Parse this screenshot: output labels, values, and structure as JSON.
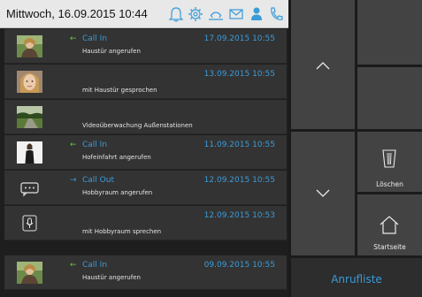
{
  "header": {
    "datetime": "Mittwoch, 16.09.2015 10:44",
    "status_icons": [
      "bell-icon",
      "gear-icon",
      "sun-icon",
      "mail-icon",
      "person-icon",
      "phone-icon"
    ]
  },
  "calls": [
    {
      "thumb": "woman-portrait",
      "direction": "in",
      "arrow": "←",
      "type": "Call In",
      "timestamp": "17.09.2015 10:55",
      "description": "Haustür angerufen"
    },
    {
      "thumb": "woman-closeup",
      "direction": "",
      "arrow": "",
      "type": "",
      "timestamp": "13.09.2015 10:55",
      "description": "mit Haustür gesprochen"
    },
    {
      "thumb": "outdoor-camera",
      "direction": "",
      "arrow": "",
      "type": "",
      "timestamp": "",
      "description": "Videoüberwachung Außenstationen"
    },
    {
      "thumb": "woman-fullbody",
      "direction": "in",
      "arrow": "←",
      "type": "Call In",
      "timestamp": "11.09.2015 10:55",
      "description": "Hofeinfahrt angerufen"
    },
    {
      "thumb": "intercom-device",
      "direction": "out",
      "arrow": "→",
      "type": "Call Out",
      "timestamp": "12.09.2015 10:55",
      "description": "Hobbyraum angerufen"
    },
    {
      "thumb": "microphone-device",
      "direction": "",
      "arrow": "",
      "type": "",
      "timestamp": "12.09.2015 10:53",
      "description": "mit Hobbyraum sprechen"
    },
    {
      "thumb": "woman-portrait",
      "direction": "in",
      "arrow": "←",
      "type": "Call In",
      "timestamp": "09.09.2015 10:55",
      "description": "Haustür angerufen"
    }
  ],
  "side": {
    "up_icon": "chevron-up-icon",
    "down_icon": "chevron-down-icon",
    "delete_label": "Löschen",
    "delete_icon": "trash-icon",
    "home_label": "Startseite",
    "home_icon": "home-icon",
    "anrufliste_label": "Anrufliste"
  },
  "colors": {
    "accent_blue": "#3a9bd9",
    "call_in_green": "#5fcf3b",
    "row_bg": "#333333",
    "tile_bg": "#434343"
  }
}
